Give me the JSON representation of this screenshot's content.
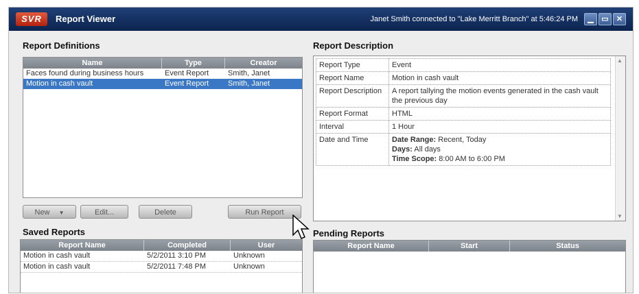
{
  "window": {
    "logo": "SVR",
    "title": "Report Viewer",
    "status": "Janet Smith connected to \"Lake Merritt Branch\" at 5:46:24 PM",
    "controls": {
      "minimize": "▁",
      "maximize": "▭",
      "close": "✕"
    }
  },
  "definitions": {
    "title": "Report Definitions",
    "columns": [
      "Name",
      "Type",
      "Creator"
    ],
    "rows": [
      [
        "Faces found during business hours",
        "Event Report",
        "Smith, Janet"
      ],
      [
        "Motion in cash vault",
        "Event Report",
        "Smith, Janet"
      ]
    ],
    "selected_row": 1
  },
  "buttons": {
    "new": "New",
    "edit": "Edit...",
    "delete": "Delete",
    "run": "Run Report",
    "new_dropdown_icon": "chevron-down-icon"
  },
  "description": {
    "title": "Report Description",
    "type_key": "Report Type",
    "type_val": "Event",
    "name_key": "Report Name",
    "name_val": "Motion in cash vault",
    "desc_key": "Report Description",
    "desc_val": "A report tallying the motion events generated in the cash vault the previous day",
    "format_key": "Report Format",
    "format_val": "HTML",
    "interval_key": "Interval",
    "interval_val": "1 Hour",
    "dt_key": "Date and Time",
    "range_label": "Date Range:",
    "range_val": " Recent, Today",
    "days_label": "Days:",
    "days_val": " All days",
    "scope_label": "Time Scope:",
    "scope_val": " 8:00 AM to 6:00 PM"
  },
  "saved": {
    "title": "Saved Reports",
    "columns": [
      "Report Name",
      "Completed",
      "User"
    ],
    "rows": [
      [
        "Motion in cash vault",
        "5/2/2011 3:10 PM",
        "Unknown"
      ],
      [
        "Motion in cash vault",
        "5/2/2011 7:48 PM",
        "Unknown"
      ]
    ]
  },
  "pending": {
    "title": "Pending Reports",
    "columns": [
      "Report Name",
      "Start",
      "Status"
    ]
  }
}
